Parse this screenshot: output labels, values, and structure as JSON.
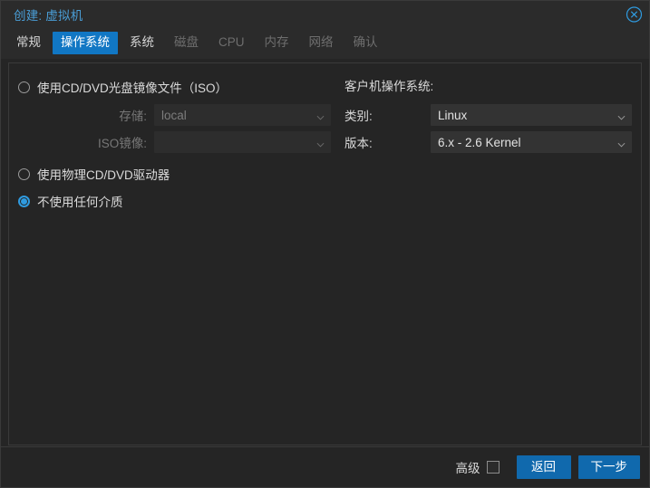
{
  "window": {
    "title": "创建: 虚拟机",
    "close_icon": "close-circle-icon"
  },
  "tabs": [
    {
      "label": "常规",
      "state": "enabled"
    },
    {
      "label": "操作系统",
      "state": "active"
    },
    {
      "label": "系统",
      "state": "enabled"
    },
    {
      "label": "磁盘",
      "state": "disabled"
    },
    {
      "label": "CPU",
      "state": "disabled"
    },
    {
      "label": "内存",
      "state": "disabled"
    },
    {
      "label": "网络",
      "state": "disabled"
    },
    {
      "label": "确认",
      "state": "disabled"
    }
  ],
  "media": {
    "option_iso": "使用CD/DVD光盘镜像文件（ISO）",
    "option_physical": "使用物理CD/DVD驱动器",
    "option_none": "不使用任何介质",
    "selected": "none",
    "storage_label": "存储:",
    "storage_value": "local",
    "iso_label": "ISO镜像:",
    "iso_value": "",
    "chevron_icon": "chevron-down-icon"
  },
  "guest_os": {
    "heading": "客户机操作系统:",
    "type_label": "类别:",
    "type_value": "Linux",
    "version_label": "版本:",
    "version_value": "6.x - 2.6 Kernel",
    "chevron_icon": "chevron-down-icon"
  },
  "footer": {
    "advanced_label": "高级",
    "advanced_checked": false,
    "back_label": "返回",
    "next_label": "下一步"
  },
  "colors": {
    "accent": "#1177c4",
    "button": "#1069ad",
    "title": "#4a9fd8",
    "radio_selected": "#2f9be0",
    "background": "#252525",
    "header_background": "#2b2b2b",
    "field_background": "#333333",
    "border": "#3a3a3a"
  }
}
